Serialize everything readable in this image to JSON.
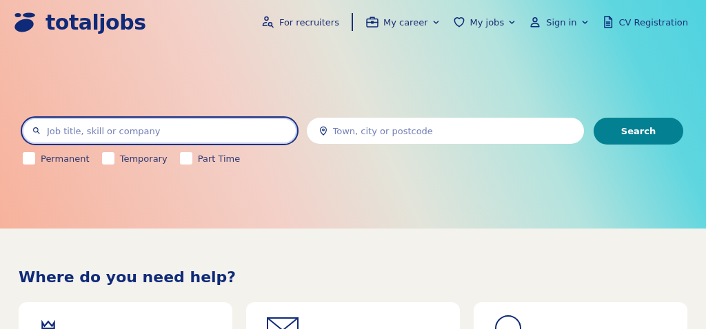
{
  "logo": "totaljobs",
  "nav": [
    {
      "label": "For recruiters",
      "dropdown": false
    },
    {
      "label": "My career",
      "dropdown": true
    },
    {
      "label": "My jobs",
      "dropdown": true
    },
    {
      "label": "Sign in",
      "dropdown": true
    },
    {
      "label": "CV Registration",
      "dropdown": false
    }
  ],
  "search": {
    "fields": [
      {
        "placeholder": "Job title, skill or company",
        "focused": true
      },
      {
        "placeholder": "Town, city or postcode",
        "focused": false
      }
    ],
    "button": "Search",
    "filters": [
      {
        "label": "Permanent",
        "checked": false
      },
      {
        "label": "Temporary",
        "checked": false
      },
      {
        "label": "Part Time",
        "checked": false
      }
    ]
  },
  "help": {
    "title": "Where do you need help?"
  }
}
